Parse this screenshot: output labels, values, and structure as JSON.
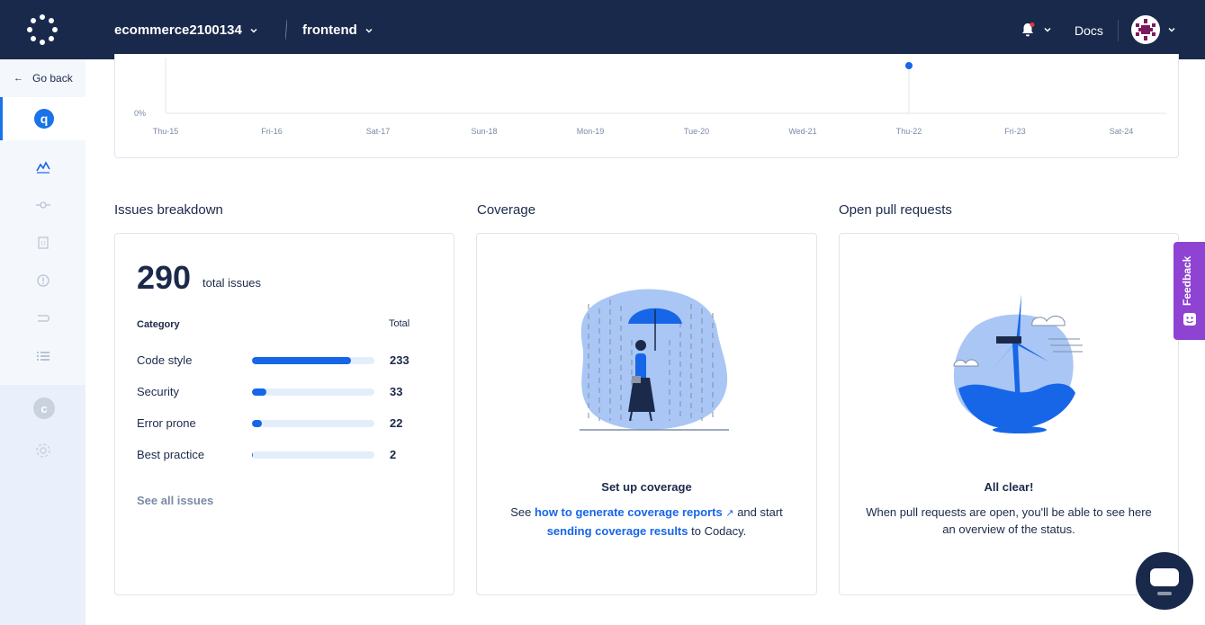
{
  "header": {
    "org": "ecommerce2100134",
    "repo": "frontend",
    "docs_label": "Docs"
  },
  "sidebar": {
    "go_back": "Go back",
    "repo_initial": "q",
    "org_initial": "c"
  },
  "chart": {
    "y_tick": "0%",
    "x_ticks": [
      "Thu-15",
      "Fri-16",
      "Sat-17",
      "Sun-18",
      "Mon-19",
      "Tue-20",
      "Wed-21",
      "Thu-22",
      "Fri-23",
      "Sat-24"
    ],
    "point_label": "Thu-22"
  },
  "issues": {
    "section_title": "Issues breakdown",
    "total": "290",
    "total_label": "total issues",
    "category_header": "Category",
    "total_header": "Total",
    "rows": [
      {
        "label": "Code style",
        "value": "233",
        "fraction": 0.81
      },
      {
        "label": "Security",
        "value": "33",
        "fraction": 0.12
      },
      {
        "label": "Error prone",
        "value": "22",
        "fraction": 0.08
      },
      {
        "label": "Best practice",
        "value": "2",
        "fraction": 0.01
      }
    ],
    "see_all": "See all issues"
  },
  "coverage": {
    "section_title": "Coverage",
    "card_title": "Set up coverage",
    "text_1": "See",
    "link_1": "how to generate coverage reports",
    "text_2": "and start",
    "link_2": "sending coverage results",
    "text_3": "to Codacy."
  },
  "pull_requests": {
    "section_title": "Open pull requests",
    "card_title": "All clear!",
    "text": "When pull requests are open, you'll be able to see here an overview of the status."
  },
  "feedback": {
    "label": "Feedback"
  },
  "colors": {
    "navy": "#18294b",
    "accent": "#1766e8",
    "feedback": "#8e43d3"
  }
}
